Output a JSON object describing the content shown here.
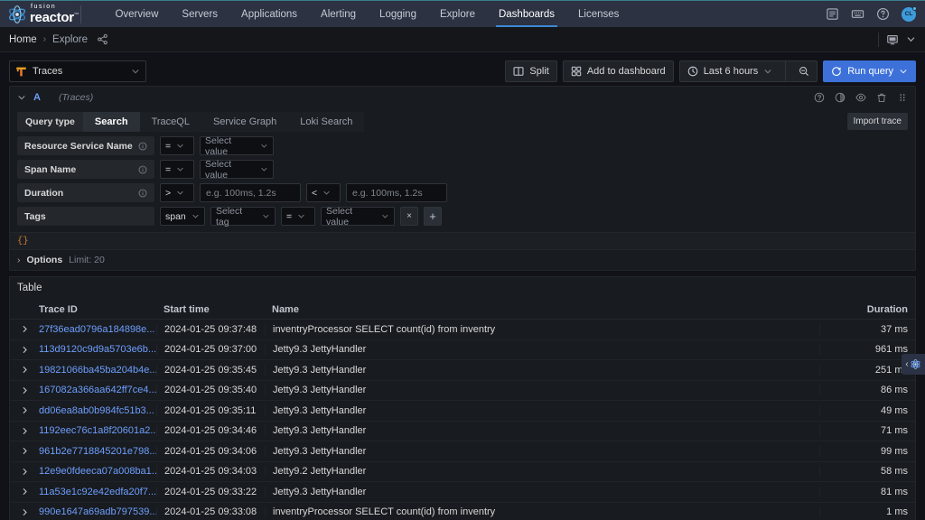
{
  "brand": {
    "fusion": "fusion",
    "reactor": "reactor",
    "tm": "™",
    "accent": "#3d86d6",
    "atom_color": "#3e9bdb"
  },
  "topnav": {
    "items": [
      {
        "label": "Overview",
        "active": false
      },
      {
        "label": "Servers",
        "active": false
      },
      {
        "label": "Applications",
        "active": false
      },
      {
        "label": "Alerting",
        "active": false
      },
      {
        "label": "Logging",
        "active": false
      },
      {
        "label": "Explore",
        "active": false
      },
      {
        "label": "Dashboards",
        "active": true
      },
      {
        "label": "Licenses",
        "active": false
      }
    ],
    "icons": [
      "news-icon",
      "keyboard-icon",
      "help-icon"
    ],
    "avatar_initials": "CL"
  },
  "breadcrumb": {
    "home": "Home",
    "separator": "›",
    "current": "Explore",
    "share_icon": "share-icon",
    "kiosk_icon": "tv-kiosk-icon",
    "chevron_icon": "chevron-down-icon"
  },
  "toolbar": {
    "datasource": "Traces",
    "datasource_icon": "tempo-datasource-icon",
    "split_label": "Split",
    "add_to_dashboard_label": "Add to dashboard",
    "time_range": "Last 6 hours",
    "zoom_out_icon": "zoom-out-icon",
    "run_query_label": "Run query",
    "run_query_color": "#3d71d9"
  },
  "query": {
    "ref_id": "A",
    "datasource_note": "(Traces)",
    "header_icons": [
      "query-help-icon",
      "duplicate-query-icon",
      "hide-response-icon",
      "remove-query-icon",
      "drag-handle-icon"
    ],
    "query_type_label": "Query type",
    "tabs": [
      {
        "label": "Search",
        "active": true
      },
      {
        "label": "TraceQL",
        "active": false
      },
      {
        "label": "Service Graph",
        "active": false
      },
      {
        "label": "Loki Search",
        "active": false
      }
    ],
    "import_trace_label": "Import trace",
    "fields": {
      "resource_service_name": {
        "label": "Resource Service Name",
        "operator": "=",
        "value_placeholder": "Select value"
      },
      "span_name": {
        "label": "Span Name",
        "operator": "=",
        "value_placeholder": "Select value"
      },
      "duration": {
        "label": "Duration",
        "min_operator": ">",
        "min_placeholder": "e.g. 100ms, 1.2s",
        "max_operator": "<",
        "max_placeholder": "e.g. 100ms, 1.2s"
      },
      "tags": {
        "label": "Tags",
        "scope": "span",
        "tag_placeholder": "Select tag",
        "operator": "=",
        "value_placeholder": "Select value",
        "remove_label": "×",
        "add_label": "+"
      }
    },
    "preview": "{}",
    "options_label": "Options",
    "options_summary": "Limit: 20",
    "options_chevron": "›"
  },
  "table": {
    "title": "Table",
    "columns": [
      "Trace ID",
      "Start time",
      "Name",
      "Duration"
    ],
    "expand_icon": "chevron-right-icon",
    "rows": [
      {
        "trace_id": "27f36ead0796a184898e...",
        "start_time": "2024-01-25 09:37:48",
        "name": "inventryProcessor SELECT count(id) from inventry",
        "duration": "37 ms"
      },
      {
        "trace_id": "113d9120c9d9a5703e6b...",
        "start_time": "2024-01-25 09:37:00",
        "name": "Jetty9.3 JettyHandler",
        "duration": "961 ms"
      },
      {
        "trace_id": "19821066ba45ba204b4e...",
        "start_time": "2024-01-25 09:35:45",
        "name": "Jetty9.3 JettyHandler",
        "duration": "251 ms"
      },
      {
        "trace_id": "167082a366aa642ff7ce4...",
        "start_time": "2024-01-25 09:35:40",
        "name": "Jetty9.3 JettyHandler",
        "duration": "86 ms"
      },
      {
        "trace_id": "dd06ea8ab0b984fc51b3...",
        "start_time": "2024-01-25 09:35:11",
        "name": "Jetty9.3 JettyHandler",
        "duration": "49 ms"
      },
      {
        "trace_id": "1192eec76c1a8f20601a2...",
        "start_time": "2024-01-25 09:34:46",
        "name": "Jetty9.3 JettyHandler",
        "duration": "71 ms"
      },
      {
        "trace_id": "961b2e7718845201e798...",
        "start_time": "2024-01-25 09:34:06",
        "name": "Jetty9.3 JettyHandler",
        "duration": "99 ms"
      },
      {
        "trace_id": "12e9e0fdeeca07a008ba1...",
        "start_time": "2024-01-25 09:34:03",
        "name": "Jetty9.2 JettyHandler",
        "duration": "58 ms"
      },
      {
        "trace_id": "11a53e1c92e42edfa20f7...",
        "start_time": "2024-01-25 09:33:22",
        "name": "Jetty9.3 JettyHandler",
        "duration": "81 ms"
      },
      {
        "trace_id": "990e1647a69adb797539...",
        "start_time": "2024-01-25 09:33:08",
        "name": "inventryProcessor SELECT count(id) from inventry",
        "duration": "1 ms"
      }
    ]
  },
  "pull_tab": {
    "chevron": "‹",
    "icon": "fusionreactor-atom-icon"
  }
}
